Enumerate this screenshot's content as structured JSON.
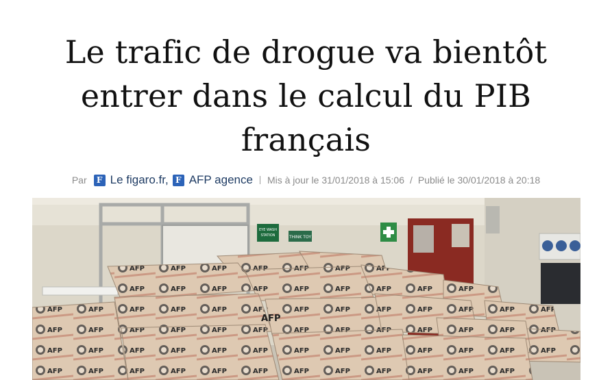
{
  "article": {
    "title_lines": [
      "Le trafic de drogue va bientôt",
      "entrer dans le calcul du PIB",
      "français"
    ],
    "byline": {
      "prefix": "Par",
      "authors": [
        {
          "name": "Le figaro.fr,",
          "icon": "figaro-logo-icon"
        },
        {
          "name": "AFP agence",
          "icon": "figaro-logo-icon"
        }
      ],
      "updated": "Mis à jour le 31/01/2018 à 15:06",
      "separator": "/",
      "published": "Publié le 30/01/2018 à 20:18"
    },
    "photo": {
      "package_label": "AFP",
      "sign_labels": [
        "EYE WASH STATION",
        "THINK TOY"
      ]
    }
  },
  "colors": {
    "title": "#111111",
    "author_link": "#1e3b63",
    "logo_bg": "#2c63b8",
    "meta_text": "#8a8a8a"
  }
}
